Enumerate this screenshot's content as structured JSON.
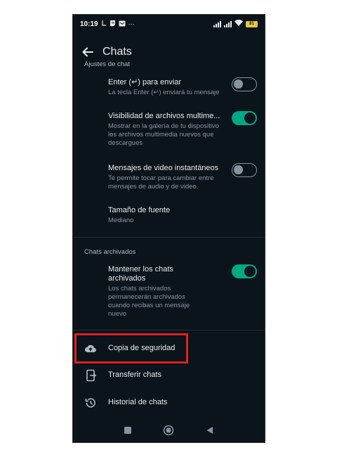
{
  "statusbar": {
    "time": "10:19",
    "dots": "···",
    "battery": "81"
  },
  "appbar": {
    "title": "Chats"
  },
  "sections": {
    "chat_settings": "Ajustes de chat",
    "archived": "Chats archivados"
  },
  "settings": {
    "enter": {
      "title": "Enter (↵) para enviar",
      "subtitle": "La tecla Enter (↵) enviará tu mensaje",
      "enabled": false
    },
    "media": {
      "title": "Visibilidad de archivos multime...",
      "subtitle_1": "Mostrar en la galería de tu dispositivo",
      "subtitle_2": "los archivos multimedia nuevos que",
      "subtitle_3": "descargues",
      "enabled": true
    },
    "video": {
      "title": "Mensajes de video instantáneos",
      "subtitle_1": "Te permite tocar para cambiar entre",
      "subtitle_2": "mensajes de audio y de video.",
      "enabled": false
    },
    "font": {
      "title": "Tamaño de fuente",
      "subtitle": "Mediano"
    },
    "keep_archived": {
      "title_1": "Mantener los chats",
      "title_2": "archivados",
      "subtitle_1": "Los chats archivados",
      "subtitle_2": "permanecerán archivados",
      "subtitle_3": "cuando recibas un mensaje",
      "subtitle_4": "nuevo",
      "enabled": true
    }
  },
  "actions": {
    "backup": "Copia de seguridad",
    "transfer": "Transferir chats",
    "history": "Historial de chats"
  },
  "colors": {
    "background": "#0b141a",
    "accent": "#00a884",
    "highlight": "#e02020"
  }
}
